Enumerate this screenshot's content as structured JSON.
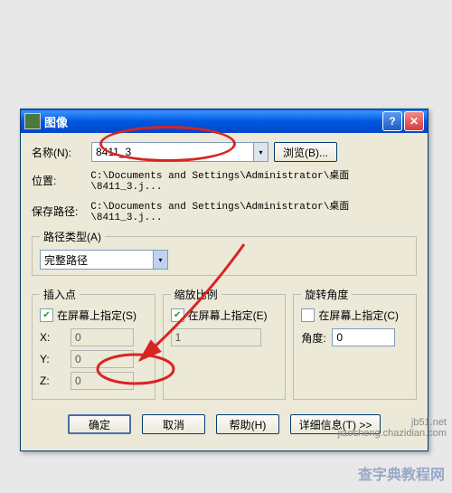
{
  "title": "图像",
  "rows": {
    "name_label": "名称(N):",
    "name_value": "8411_3",
    "browse_btn": "浏览(B)...",
    "location_label": "位置:",
    "location_value": "C:\\Documents and Settings\\Administrator\\桌面\\8411_3.j...",
    "savepath_label": "保存路径:",
    "savepath_value": "C:\\Documents and Settings\\Administrator\\桌面\\8411_3.j..."
  },
  "pathtype": {
    "legend": "路径类型(A)",
    "value": "完整路径"
  },
  "insert": {
    "legend": "插入点",
    "chk_label": "在屏幕上指定(S)",
    "chk_checked": true,
    "x_label": "X:",
    "x_val": "0",
    "y_label": "Y:",
    "y_val": "0",
    "z_label": "Z:",
    "z_val": "0"
  },
  "scale": {
    "legend": "缩放比例",
    "chk_label": "在屏幕上指定(E)",
    "chk_checked": true,
    "val": "1"
  },
  "rotate": {
    "legend": "旋转角度",
    "chk_label": "在屏幕上指定(C)",
    "chk_checked": false,
    "angle_label": "角度:",
    "angle_val": "0"
  },
  "buttons": {
    "ok": "确定",
    "cancel": "取消",
    "help": "帮助(H)",
    "details": "详细信息(T) >>"
  },
  "watermark1": "jb51.net",
  "watermark1b": "jiaocheng.chazidian.com",
  "watermark2": "查字典教程网"
}
